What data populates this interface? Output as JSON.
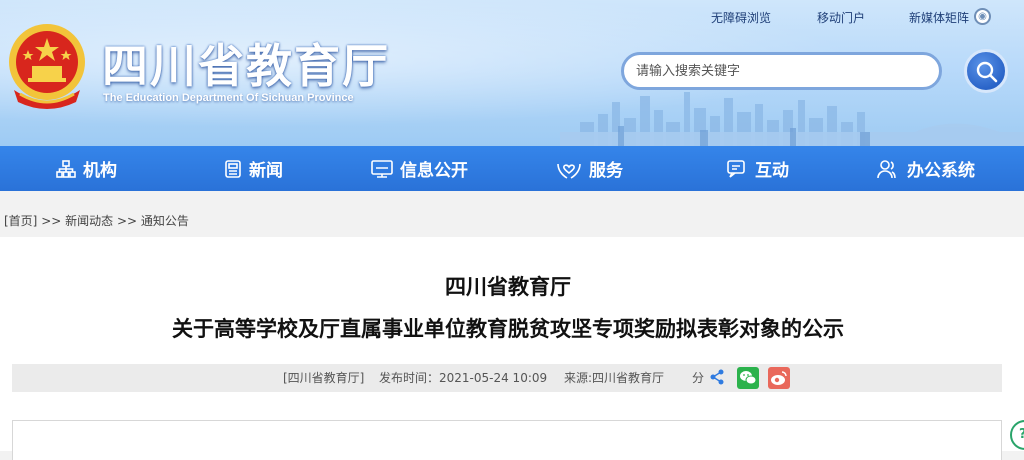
{
  "header": {
    "site_title": "四川省教育厅",
    "site_subtitle": "The Education Department Of Sichuan Province",
    "top_links": [
      "无障碍浏览",
      "移动门户",
      "新媒体矩阵"
    ],
    "search_placeholder": "请输入搜索关键字"
  },
  "nav": {
    "items": [
      {
        "label": "机构",
        "icon": "org-chart-icon"
      },
      {
        "label": "新闻",
        "icon": "newspaper-icon"
      },
      {
        "label": "信息公开",
        "icon": "monitor-icon"
      },
      {
        "label": "服务",
        "icon": "hands-heart-icon"
      },
      {
        "label": "互动",
        "icon": "chat-icon"
      },
      {
        "label": "办公系统",
        "icon": "users-icon"
      }
    ]
  },
  "breadcrumb": {
    "home": "[首页]",
    "sep": " >> ",
    "level1": "新闻动态",
    "level2": "通知公告"
  },
  "article": {
    "title_line1": "四川省教育厅",
    "title_line2": "关于高等学校及厅直属事业单位教育脱贫攻坚专项奖励拟表彰对象的公示",
    "author": "[四川省教育厅]",
    "publish_time": "发布时间：2021-05-24 10:09",
    "source": "来源:四川省教育厅",
    "share_label": "分"
  },
  "colors": {
    "nav_blue": "#2f7be0",
    "header_sky": "#b9dafa",
    "wechat_green": "#2bb24c",
    "weibo_red": "#e9685b"
  }
}
